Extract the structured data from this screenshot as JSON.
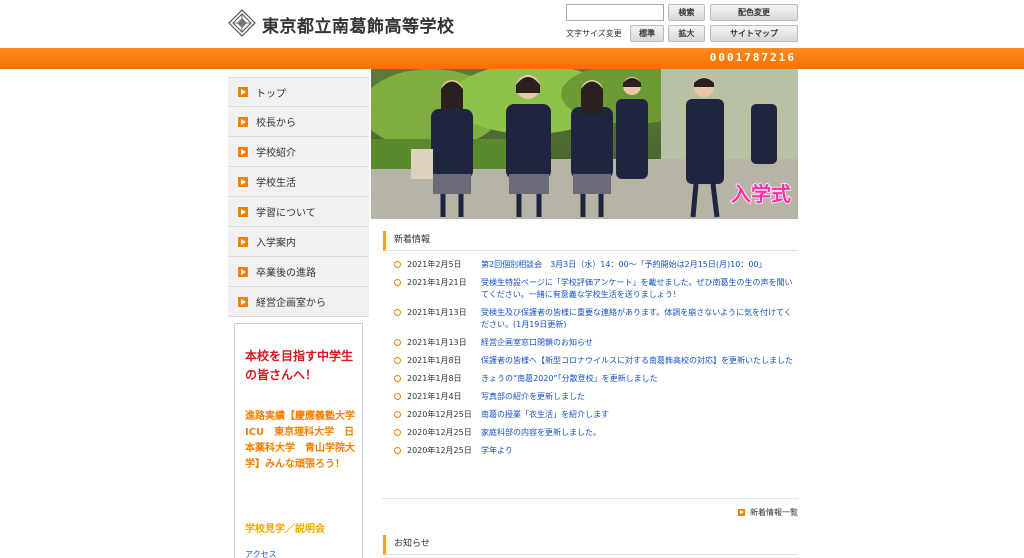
{
  "header": {
    "site_title": "東京都立南葛飾高等学校",
    "search_button": "検索",
    "color_button": "配色変更",
    "fontsize_label": "文字サイズ変更",
    "normal_button": "標準",
    "large_button": "拡大",
    "sitemap_button": "サイトマップ",
    "search_value": ""
  },
  "counter": "0001787216",
  "nav": [
    {
      "label": "トップ"
    },
    {
      "label": "校長から"
    },
    {
      "label": "学校紹介"
    },
    {
      "label": "学校生活"
    },
    {
      "label": "学習について"
    },
    {
      "label": "入学案内"
    },
    {
      "label": "卒業後の進路"
    },
    {
      "label": "経営企画室から"
    }
  ],
  "side_box": {
    "headline": "本校を目指す中学生の皆さんへ！",
    "achievements": "進路実績【慶應義塾大学　ICU　東京理科大学　日本薬科大学　青山学院大学】みんな頑張ろう！",
    "open_school": "学校見学／説明会",
    "access": "アクセス"
  },
  "hero": {
    "overlay_text": "入学式"
  },
  "news": {
    "heading": "新着情報",
    "items": [
      {
        "date": "2021年2月5日",
        "text": "第2回個別相談会　3月3日（水）14：00〜「予約開始は2月15日(月)10：00」"
      },
      {
        "date": "2021年1月21日",
        "text": "受検生特設ページに「学校評価アンケート」を載せました。ぜひ南葛生の生の声を聞いてください。一緒に有意義な学校生活を送りましょう！"
      },
      {
        "date": "2021年1月13日",
        "text": "受検生及び保護者の皆様に重要な連絡があります。体調を崩さないように気を付けてください。(1月19日更新)"
      },
      {
        "date": "2021年1月13日",
        "text": "経営企画室窓口閉鎖のお知らせ"
      },
      {
        "date": "2021年1月8日",
        "text": "保護者の皆様へ【新型コロナウイルスに対する南葛飾高校の対応】を更新いたしました"
      },
      {
        "date": "2021年1月8日",
        "text": "きょうの“南葛2020”「分散登校」を更新しました"
      },
      {
        "date": "2021年1月4日",
        "text": "写真部の紹介を更新しました"
      },
      {
        "date": "2020年12月25日",
        "text": "南葛の授業「衣生活」を紹介します"
      },
      {
        "date": "2020年12月25日",
        "text": "家庭科部の内容を更新しました。"
      },
      {
        "date": "2020年12月25日",
        "text": "学年より"
      }
    ],
    "more": "新着情報一覧"
  },
  "notice": {
    "heading": "お知らせ"
  },
  "colors": {
    "accent_orange": "#f57f00",
    "link_blue": "#1550c8",
    "alert_red": "#e0141e"
  }
}
